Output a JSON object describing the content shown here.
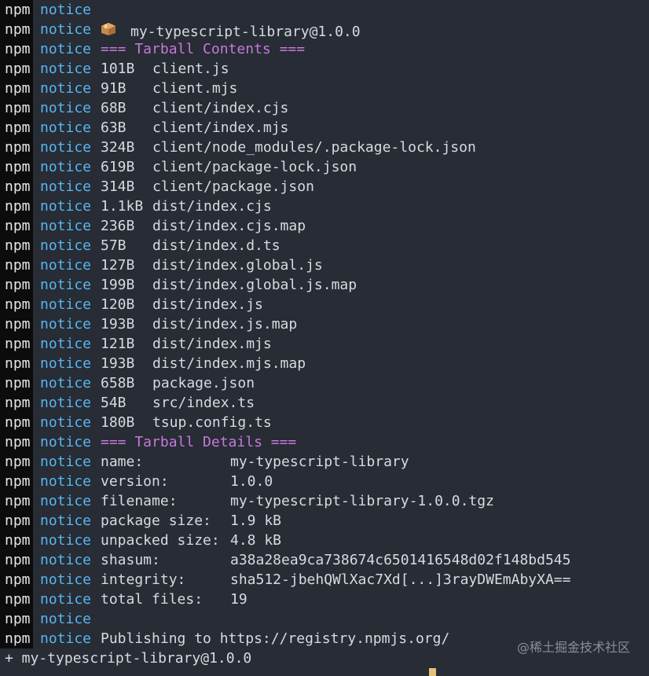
{
  "terminal": {
    "prefix": "npm",
    "level": "notice",
    "package_line": "my-typescript-library@1.0.0",
    "contents_header": "=== Tarball Contents ===",
    "files": [
      {
        "size": "101B",
        "path": "client.js"
      },
      {
        "size": "91B",
        "path": "client.mjs"
      },
      {
        "size": "68B",
        "path": "client/index.cjs"
      },
      {
        "size": "63B",
        "path": "client/index.mjs"
      },
      {
        "size": "324B",
        "path": "client/node_modules/.package-lock.json"
      },
      {
        "size": "619B",
        "path": "client/package-lock.json"
      },
      {
        "size": "314B",
        "path": "client/package.json"
      },
      {
        "size": "1.1kB",
        "path": "dist/index.cjs"
      },
      {
        "size": "236B",
        "path": "dist/index.cjs.map"
      },
      {
        "size": "57B",
        "path": "dist/index.d.ts"
      },
      {
        "size": "127B",
        "path": "dist/index.global.js"
      },
      {
        "size": "199B",
        "path": "dist/index.global.js.map"
      },
      {
        "size": "120B",
        "path": "dist/index.js"
      },
      {
        "size": "193B",
        "path": "dist/index.js.map"
      },
      {
        "size": "121B",
        "path": "dist/index.mjs"
      },
      {
        "size": "193B",
        "path": "dist/index.mjs.map"
      },
      {
        "size": "658B",
        "path": "package.json"
      },
      {
        "size": "54B",
        "path": "src/index.ts"
      },
      {
        "size": "180B",
        "path": "tsup.config.ts"
      }
    ],
    "details_header": "=== Tarball Details ===",
    "details": [
      {
        "key": "name:",
        "value": "my-typescript-library"
      },
      {
        "key": "version:",
        "value": "1.0.0"
      },
      {
        "key": "filename:",
        "value": "my-typescript-library-1.0.0.tgz"
      },
      {
        "key": "package size:",
        "value": "1.9 kB"
      },
      {
        "key": "unpacked size:",
        "value": "4.8 kB"
      },
      {
        "key": "shasum:",
        "value": "a38a28ea9ca738674c6501416548d02f148bd545"
      },
      {
        "key": "integrity:",
        "value": "sha512-jbehQWlXac7Xd[...]3rayDWEmAbyXA=="
      },
      {
        "key": "total files:",
        "value": "19"
      }
    ],
    "publishing": "Publishing to https://registry.npmjs.org/",
    "result": "+ my-typescript-library@1.0.0",
    "package_icon": "package-box-icon"
  },
  "watermark": "@稀土掘金技术社区",
  "colors": {
    "background": "#282c34",
    "notice": "#56b6f2",
    "header": "#c678dd",
    "cursor": "#e5c07b"
  }
}
